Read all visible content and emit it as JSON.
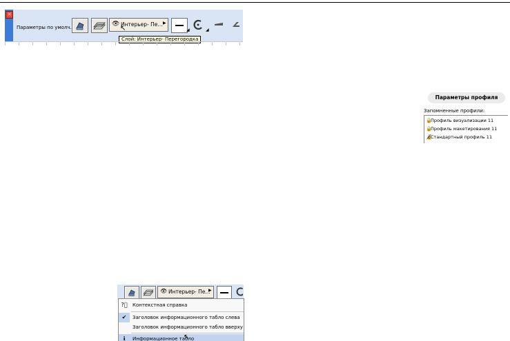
{
  "top_bar": {
    "label": "Параметры по умолч.",
    "close_glyph": "✕",
    "layer_button": "Интерьер- Пе...",
    "tooltip": "Слой: Интерьер- Перегородка"
  },
  "profile_panel": {
    "title": "Параметры профиля",
    "list_label": "Запомненные профили:",
    "profiles": [
      {
        "name": "Профиль визуализации 11",
        "icon": "lock-icon"
      },
      {
        "name": "Профиль макетирования 11",
        "icon": "lock-icon"
      },
      {
        "name": "Стандартный профиль 11",
        "icon": "lock-check-icon"
      }
    ]
  },
  "bottom_bar": {
    "layer_button": "Интерьер- Пе..."
  },
  "context_menu": {
    "items": [
      {
        "label": "Контекстная справка",
        "icon": "help-icon",
        "checked": false
      },
      {
        "label": "Заголовок информационного табло слева",
        "checked": true
      },
      {
        "label": "Заголовок информационного табло вверху",
        "checked": false
      },
      {
        "label": "Информационное табло",
        "icon": "info-icon",
        "highlighted": true
      }
    ]
  }
}
